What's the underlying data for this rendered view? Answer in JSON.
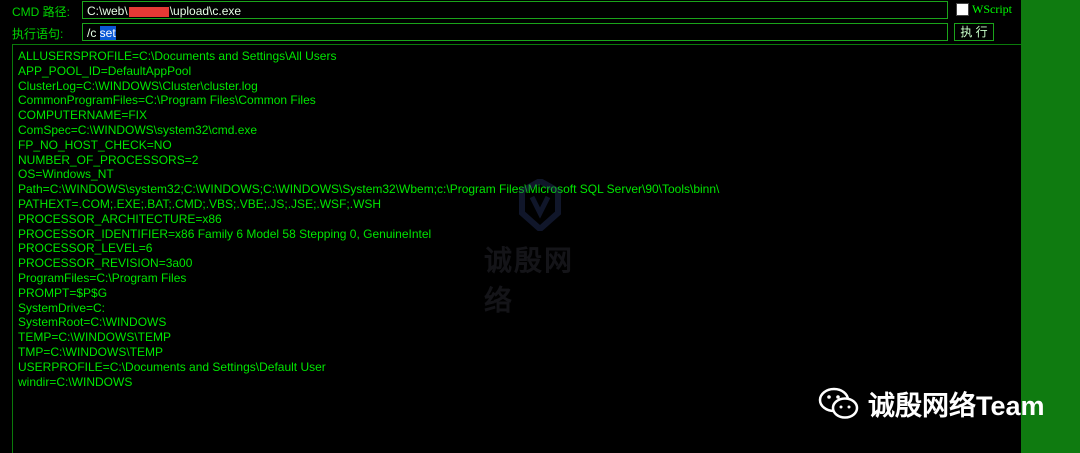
{
  "header": {
    "cmd_path_label": "CMD 路径:",
    "cmd_path_value_prefix": "C:\\web\\",
    "cmd_path_value_suffix": "\\upload\\c.exe",
    "wscript_label": "WScript",
    "exec_statement_label": "执行语句:",
    "exec_statement_prefix": "/c ",
    "exec_statement_selected": "set",
    "exec_button_label": "执 行"
  },
  "output": {
    "lines": [
      "ALLUSERSPROFILE=C:\\Documents and Settings\\All Users",
      "APP_POOL_ID=DefaultAppPool",
      "ClusterLog=C:\\WINDOWS\\Cluster\\cluster.log",
      "CommonProgramFiles=C:\\Program Files\\Common Files",
      "COMPUTERNAME=FIX",
      "ComSpec=C:\\WINDOWS\\system32\\cmd.exe",
      "FP_NO_HOST_CHECK=NO",
      "NUMBER_OF_PROCESSORS=2",
      "OS=Windows_NT",
      "Path=C:\\WINDOWS\\system32;C:\\WINDOWS;C:\\WINDOWS\\System32\\Wbem;c:\\Program Files\\Microsoft SQL Server\\90\\Tools\\binn\\",
      "PATHEXT=.COM;.EXE;.BAT;.CMD;.VBS;.VBE;.JS;.JSE;.WSF;.WSH",
      "PROCESSOR_ARCHITECTURE=x86",
      "PROCESSOR_IDENTIFIER=x86 Family 6 Model 58 Stepping 0, GenuineIntel",
      "PROCESSOR_LEVEL=6",
      "PROCESSOR_REVISION=3a00",
      "ProgramFiles=C:\\Program Files",
      "PROMPT=$P$G",
      "SystemDrive=C:",
      "SystemRoot=C:\\WINDOWS",
      "TEMP=C:\\WINDOWS\\TEMP",
      "TMP=C:\\WINDOWS\\TEMP",
      "USERPROFILE=C:\\Documents and Settings\\Default User",
      "windir=C:\\WINDOWS"
    ]
  },
  "watermark": {
    "center_text": "诚殷网络",
    "brand_text": "诚殷网络Team",
    "center_icon": "brand-logo-icon",
    "brand_icon": "wechat-icon"
  },
  "colors": {
    "output_text": "#00e600",
    "label_text": "#00d400",
    "page_background": "#000000",
    "side_strip": "#0f7b10"
  }
}
